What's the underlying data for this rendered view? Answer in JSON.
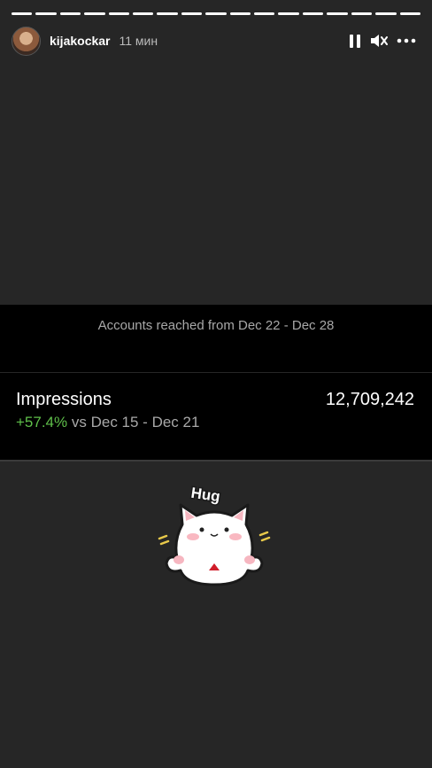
{
  "story": {
    "segments": 17,
    "username": "kijakockar",
    "time": "11 мин"
  },
  "controls": {
    "pause": "pause-icon",
    "mute": "mute-icon",
    "more": "more-icon"
  },
  "insights": {
    "reach_caption": "Accounts reached from Dec 22 - Dec 28",
    "impressions_label": "Impressions",
    "impressions_value": "12,709,242",
    "change_pct": "+57.4%",
    "change_text": "vs Dec 15 - Dec 21"
  },
  "sticker": {
    "text": "Hug"
  },
  "colors": {
    "background": "#262626",
    "card": "#000000",
    "positive": "#5fbf4a",
    "muted": "#a8a8a8"
  }
}
